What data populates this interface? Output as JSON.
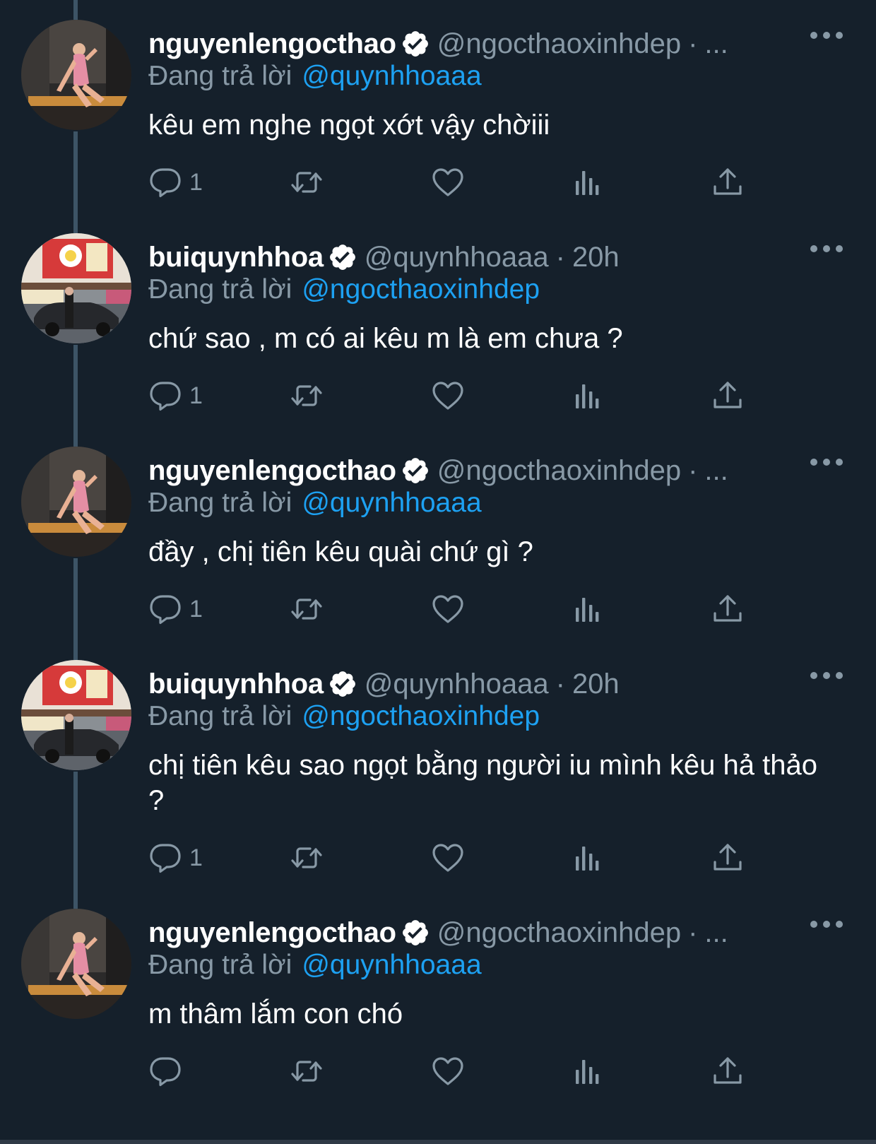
{
  "colors": {
    "background": "#15202b",
    "secondary_text": "#8899a6",
    "mention": "#1da1f2",
    "thread_line": "#3d5466"
  },
  "tweets": [
    {
      "display_name": "nguyenlengocthao",
      "handle": "@ngocthaoxinhdep",
      "separator": "·",
      "time": "...",
      "replying_label": "Đang trả lời",
      "replying_to": "@quynhhoaaa",
      "text": "kêu em nghe ngọt xớt vậy chờiii",
      "reply_count": "1",
      "avatar": "avatar-woman-pink-dress"
    },
    {
      "display_name": "buiquynhhoa",
      "handle": "@quynhhoaaa",
      "separator": "·",
      "time": "20h",
      "replying_label": "Đang trả lời",
      "replying_to": "@ngocthaoxinhdep",
      "text": "chứ sao , m có ai kêu m là em chưa ?",
      "reply_count": "1",
      "avatar": "avatar-street-car"
    },
    {
      "display_name": "nguyenlengocthao",
      "handle": "@ngocthaoxinhdep",
      "separator": "·",
      "time": "...",
      "replying_label": "Đang trả lời",
      "replying_to": "@quynhhoaaa",
      "text": "đầy , chị tiên kêu quài chứ gì ?",
      "reply_count": "1",
      "avatar": "avatar-woman-pink-dress"
    },
    {
      "display_name": "buiquynhhoa",
      "handle": "@quynhhoaaa",
      "separator": "·",
      "time": "20h",
      "replying_label": "Đang trả lời",
      "replying_to": "@ngocthaoxinhdep",
      "text": "chị tiên kêu sao ngọt bằng người iu mình kêu hả thảo ?",
      "reply_count": "1",
      "avatar": "avatar-street-car"
    },
    {
      "display_name": "nguyenlengocthao",
      "handle": "@ngocthaoxinhdep",
      "separator": "·",
      "time": "...",
      "replying_label": "Đang trả lời",
      "replying_to": "@quynhhoaaa",
      "text": "m thâm lắm con chó",
      "reply_count": "",
      "avatar": "avatar-woman-pink-dress"
    }
  ]
}
